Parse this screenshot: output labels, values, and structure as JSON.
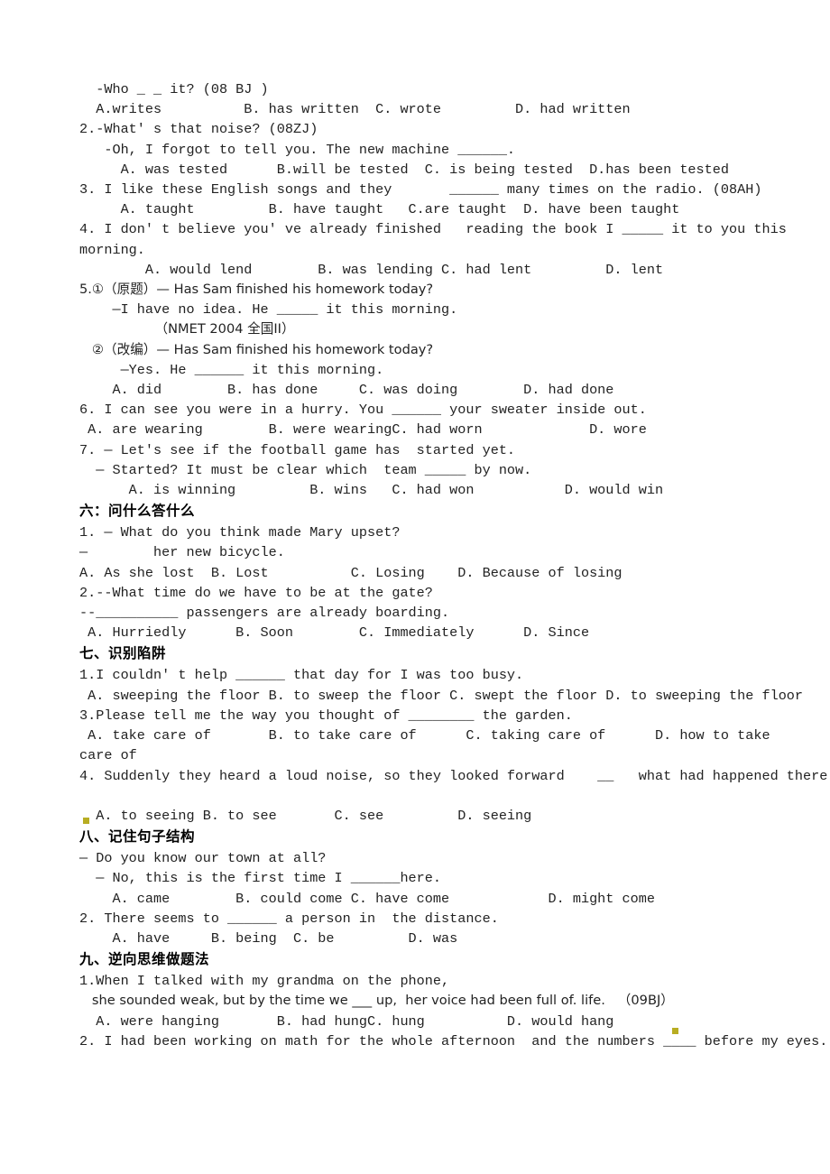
{
  "document": {
    "type": "english-grammar-worksheet",
    "language_note": "Chinese section headings with English multiple-choice grammar questions",
    "lines": [
      "  -Who _ _ it? (08 BJ )",
      "  A.writes          B. has written  C. wrote         D. had written",
      "2.-What' s that noise? (08ZJ)",
      "   -Oh, I forgot to tell you. The new machine ______.",
      "     A. was tested      B.will be tested  C. is being tested  D.has been tested",
      "3. I like these English songs and they       ______ many times on the radio. (08AH)",
      "     A. taught         B. have taught   C.are taught  D. have been taught",
      "4. I don' t believe you' ve already finished   reading the book I _____ it to you this",
      "morning.",
      "        A. would lend        B. was lending C. had lent         D. lent",
      "5.①（原题）— Has Sam finished his homework today?",
      "    —I have no idea. He _____ it this morning.",
      "                  （NMET 2004 全国II）",
      "   ②（改编）— Has Sam finished his homework today?",
      "     —Yes. He ______ it this morning.",
      "    A. did        B. has done     C. was doing        D. had done",
      "6. I can see you were in a hurry. You ______ your sweater inside out.",
      " A. are wearing        B. were wearingC. had worn             D. wore",
      "7. — Let's see if the football game has  started yet.",
      "  — Started? It must be clear which  team _____ by now.",
      "      A. is winning         B. wins   C. had won           D. would win"
    ],
    "section_six": {
      "heading": "六：问什么答什么",
      "lines": [
        "1. — What do you think made Mary upset?",
        "—        her new bicycle.",
        "A. As she lost  B. Lost          C. Losing    D. Because of losing",
        "2.--What time do we have to be at the gate?",
        "--__________ passengers are already boarding.",
        " A. Hurriedly      B. Soon        C. Immediately      D. Since"
      ]
    },
    "section_seven": {
      "heading": "七、识别陷阱",
      "lines": [
        "1.I couldn' t help ______ that day for I was too busy.",
        " A. sweeping the floor B. to sweep the floor C. swept the floor D. to sweeping the floor",
        "3.Please tell me the way you thought of ________ the garden.",
        " A. take care of       B. to take care of      C. taking care of      D. how to take",
        "care of",
        "4. Suddenly they heard a loud noise, so they looked forward    __   what had happened there.",
        "  A. to seeing B. to see       C. see         D. seeing"
      ]
    },
    "section_eight": {
      "heading": "八、记住句子结构",
      "lines": [
        "— Do you know our town at all?",
        "  — No, this is the first time I ______here.",
        "    A. came        B. could come C. have come            D. might come",
        "2. There seems to ______ a person in  the distance.",
        "    A. have     B. being  C. be         D. was"
      ]
    },
    "section_nine": {
      "heading": "九、逆向思维做题法",
      "lines": [
        "1.When I talked with my grandma on the phone,",
        "   she sounded weak, but by the time we ___ up,  her voice had been full of. life.   （09BJ）",
        "  A. were hanging       B. had hungC. hung          D. would hang",
        "2. I had been working on math for the whole afternoon  and the numbers ____ before my eyes."
      ]
    }
  }
}
